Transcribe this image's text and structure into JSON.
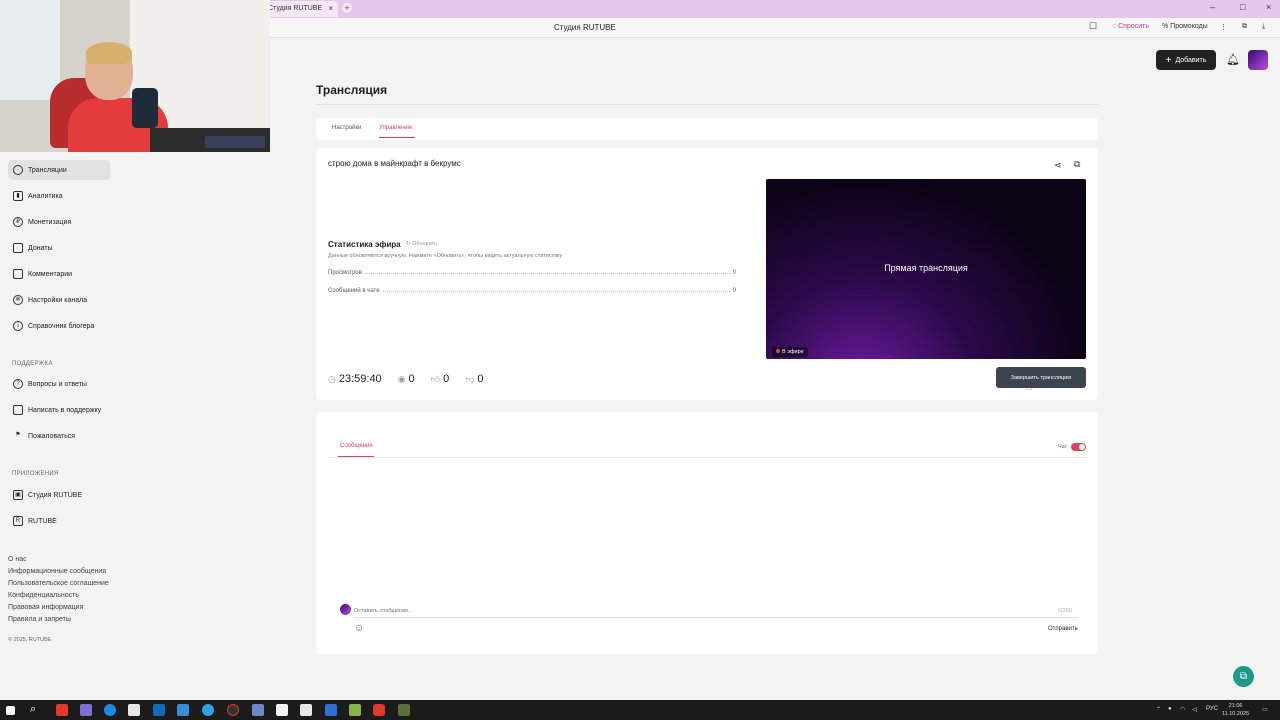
{
  "browser": {
    "tab_title": "Студия RUTUBE",
    "tab_close": "×",
    "new_tab": "+",
    "window_controls": [
      "–",
      "□",
      "×"
    ],
    "page_title": "Студия RUTUBE",
    "bookmark_icon": "bookmark-icon",
    "toolbar_items": [
      "Спросить",
      "Промокоды"
    ],
    "menu_glyph": "⋮"
  },
  "sidebar": {
    "main_items": [
      {
        "label": "Трансляции",
        "icon": "broadcast-icon",
        "active": true
      },
      {
        "label": "Аналитика",
        "icon": "analytics-icon",
        "active": false
      },
      {
        "label": "Монетизация",
        "icon": "monetization-icon",
        "active": false
      },
      {
        "label": "Донаты",
        "icon": "wallet-icon",
        "active": false
      },
      {
        "label": "Комментарии",
        "icon": "comment-icon",
        "active": false
      },
      {
        "label": "Настройки канала",
        "icon": "gear-icon",
        "active": false
      },
      {
        "label": "Справочник блогера",
        "icon": "info-icon",
        "active": false
      }
    ],
    "support_head": "ПОДДЕРЖКА",
    "support_items": [
      {
        "label": "Вопросы и ответы",
        "icon": "question-icon"
      },
      {
        "label": "Написать в поддержку",
        "icon": "mail-icon"
      },
      {
        "label": "Пожаловаться",
        "icon": "flag-icon"
      }
    ],
    "apps_head": "ПРИЛОЖЕНИЯ",
    "apps_items": [
      {
        "label": "Студия RUTUBE",
        "icon": "rutube-studio-icon"
      },
      {
        "label": "RUTUBE",
        "icon": "rutube-icon"
      }
    ],
    "footer_links": [
      "О нас",
      "Информационные сообщения",
      "Пользовательское соглашение",
      "Конфиденциальность",
      "Правовая информация",
      "Правила и запреты"
    ],
    "copyright": "© 2025, RUTUBE"
  },
  "header": {
    "add_button": "Добавить"
  },
  "main": {
    "page_title": "Трансляция",
    "tabs": [
      {
        "label": "Настройки",
        "active": false
      },
      {
        "label": "Управление",
        "active": true
      }
    ],
    "stream_title": "строю дома в майнкрафт в бекрумс",
    "player": {
      "overlay_text": "Прямая трансляция",
      "live_badge": "В эфире"
    },
    "stats": {
      "heading": "Статистика эфира",
      "refresh_label": "Обновить",
      "hint": "Данные обновляются вручную. Нажмите «Обновить», чтобы видеть актуальную статистику",
      "rows": [
        {
          "label": "Просмотров",
          "value": "0"
        },
        {
          "label": "Сообщений в чате",
          "value": "0"
        }
      ]
    },
    "bottom_stats": {
      "duration": "23:59:40",
      "viewers": "0",
      "likes": "0",
      "dislikes": "0"
    },
    "end_button": "Завершить трансляцию"
  },
  "chat": {
    "tab_label": "Сообщения",
    "chat_toggle_label": "Чат",
    "chat_enabled": true,
    "input_placeholder": "Оставить сообщение...",
    "char_count": "0/200",
    "send_label": "Отправить"
  },
  "taskbar": {
    "lang": "РУС",
    "time": "21:06",
    "date": "11.10.2025"
  },
  "colors": {
    "accent": "#e1425a",
    "end_button": "#3d4551",
    "help_fab": "#1d9a8a"
  }
}
